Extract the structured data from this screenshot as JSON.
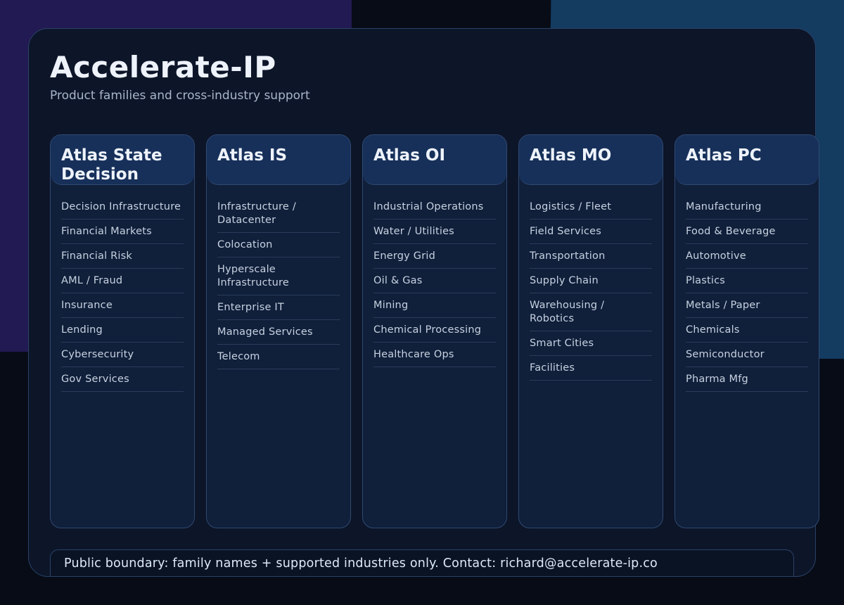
{
  "header": {
    "title": "Accelerate-IP",
    "subtitle": "Product families and cross-industry support"
  },
  "families": [
    {
      "name": "Atlas State Decision",
      "industries": [
        "Decision Infrastructure",
        "Financial Markets",
        "Financial Risk",
        "AML / Fraud",
        "Insurance",
        "Lending",
        "Cybersecurity",
        "Gov Services"
      ]
    },
    {
      "name": "Atlas IS",
      "industries": [
        "Infrastructure / Datacenter",
        "Colocation",
        "Hyperscale Infrastructure",
        "Enterprise IT",
        "Managed Services",
        "Telecom"
      ]
    },
    {
      "name": "Atlas OI",
      "industries": [
        "Industrial Operations",
        "Water / Utilities",
        "Energy Grid",
        "Oil & Gas",
        "Mining",
        "Chemical Processing",
        "Healthcare Ops"
      ]
    },
    {
      "name": "Atlas MO",
      "industries": [
        "Logistics / Fleet",
        "Field Services",
        "Transportation",
        "Supply Chain",
        "Warehousing / Robotics",
        "Smart Cities",
        "Facilities"
      ]
    },
    {
      "name": "Atlas PC",
      "industries": [
        "Manufacturing",
        "Food & Beverage",
        "Automotive",
        "Plastics",
        "Metals / Paper",
        "Chemicals",
        "Semiconductor",
        "Pharma Mfg"
      ]
    }
  ],
  "footer": {
    "text": "Public boundary: family names + supported industries only. Contact: richard@accelerate-ip.co"
  },
  "colors": {
    "background": "#070c17",
    "panel": "#0d1529",
    "card_header": "#17305a",
    "accent_purple": "#221a52",
    "accent_blue": "#143b60"
  }
}
